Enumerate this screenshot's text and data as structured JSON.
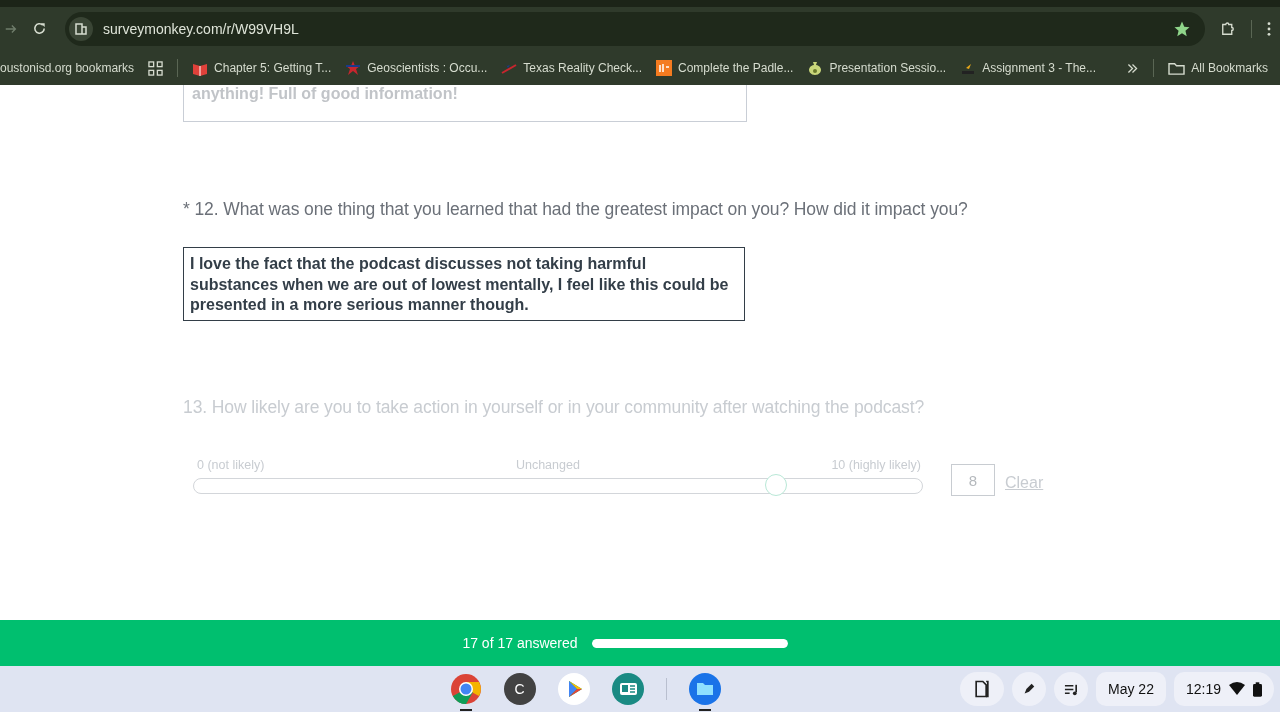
{
  "browser": {
    "url": "surveymonkey.com/r/W99VH9L",
    "starred": true,
    "bookmarks": [
      {
        "label": "oustonisd.org bookmarks",
        "kind": "plain"
      },
      {
        "label": "Chapter 5: Getting T...",
        "kind": "book"
      },
      {
        "label": "Geoscientists : Occu...",
        "kind": "star"
      },
      {
        "label": "Texas Reality Check...",
        "kind": "swoosh"
      },
      {
        "label": "Complete the Padle...",
        "kind": "its"
      },
      {
        "label": "Presentation Sessio...",
        "kind": "bag"
      },
      {
        "label": "Assignment 3 - The...",
        "kind": "hcc"
      }
    ],
    "all_bookmarks": "All Bookmarks"
  },
  "survey": {
    "previous_answer": "anything! Full of good information!",
    "questions": [
      {
        "kind": "text",
        "title": "* 12. What was one thing that you learned that had the greatest impact on you? How did it impact you?",
        "answer": "I love the fact that the podcast discusses not taking harmful substances when we are out of lowest mentally, I feel like this could be presented in a more serious manner though.",
        "disabled": false
      },
      {
        "kind": "slider",
        "title": "13. How likely are you to take action in yourself or in your community after watching the podcast?",
        "disabled": true,
        "labels": [
          "0 (not likely)",
          "Unchanged",
          "10 (highly likely)"
        ],
        "level": 0.8,
        "value": "8",
        "clear": "Clear"
      }
    ]
  },
  "progress": {
    "text": "17 of 17 answered",
    "level": 1
  },
  "shelf": {
    "apps": [
      {
        "kind": "chrome",
        "active": true
      },
      {
        "kind": "letter",
        "letter": "C",
        "active": false
      },
      {
        "kind": "play",
        "active": false
      },
      {
        "kind": "news",
        "active": false
      },
      {
        "kind": "files",
        "active": true
      }
    ],
    "date": "May 22",
    "time": "12:19"
  }
}
